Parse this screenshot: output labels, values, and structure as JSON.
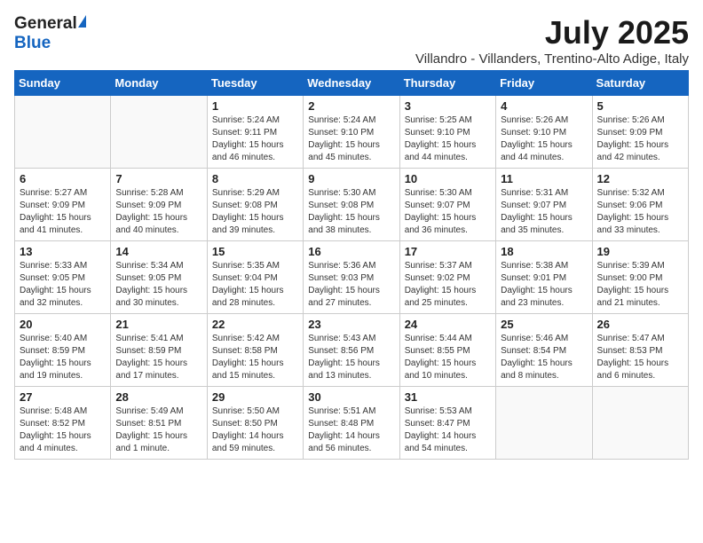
{
  "header": {
    "logo_general": "General",
    "logo_blue": "Blue",
    "month_title": "July 2025",
    "location": "Villandro - Villanders, Trentino-Alto Adige, Italy"
  },
  "calendar": {
    "days_of_week": [
      "Sunday",
      "Monday",
      "Tuesday",
      "Wednesday",
      "Thursday",
      "Friday",
      "Saturday"
    ],
    "weeks": [
      [
        {
          "day": "",
          "info": ""
        },
        {
          "day": "",
          "info": ""
        },
        {
          "day": "1",
          "info": "Sunrise: 5:24 AM\nSunset: 9:11 PM\nDaylight: 15 hours and 46 minutes."
        },
        {
          "day": "2",
          "info": "Sunrise: 5:24 AM\nSunset: 9:10 PM\nDaylight: 15 hours and 45 minutes."
        },
        {
          "day": "3",
          "info": "Sunrise: 5:25 AM\nSunset: 9:10 PM\nDaylight: 15 hours and 44 minutes."
        },
        {
          "day": "4",
          "info": "Sunrise: 5:26 AM\nSunset: 9:10 PM\nDaylight: 15 hours and 44 minutes."
        },
        {
          "day": "5",
          "info": "Sunrise: 5:26 AM\nSunset: 9:09 PM\nDaylight: 15 hours and 42 minutes."
        }
      ],
      [
        {
          "day": "6",
          "info": "Sunrise: 5:27 AM\nSunset: 9:09 PM\nDaylight: 15 hours and 41 minutes."
        },
        {
          "day": "7",
          "info": "Sunrise: 5:28 AM\nSunset: 9:09 PM\nDaylight: 15 hours and 40 minutes."
        },
        {
          "day": "8",
          "info": "Sunrise: 5:29 AM\nSunset: 9:08 PM\nDaylight: 15 hours and 39 minutes."
        },
        {
          "day": "9",
          "info": "Sunrise: 5:30 AM\nSunset: 9:08 PM\nDaylight: 15 hours and 38 minutes."
        },
        {
          "day": "10",
          "info": "Sunrise: 5:30 AM\nSunset: 9:07 PM\nDaylight: 15 hours and 36 minutes."
        },
        {
          "day": "11",
          "info": "Sunrise: 5:31 AM\nSunset: 9:07 PM\nDaylight: 15 hours and 35 minutes."
        },
        {
          "day": "12",
          "info": "Sunrise: 5:32 AM\nSunset: 9:06 PM\nDaylight: 15 hours and 33 minutes."
        }
      ],
      [
        {
          "day": "13",
          "info": "Sunrise: 5:33 AM\nSunset: 9:05 PM\nDaylight: 15 hours and 32 minutes."
        },
        {
          "day": "14",
          "info": "Sunrise: 5:34 AM\nSunset: 9:05 PM\nDaylight: 15 hours and 30 minutes."
        },
        {
          "day": "15",
          "info": "Sunrise: 5:35 AM\nSunset: 9:04 PM\nDaylight: 15 hours and 28 minutes."
        },
        {
          "day": "16",
          "info": "Sunrise: 5:36 AM\nSunset: 9:03 PM\nDaylight: 15 hours and 27 minutes."
        },
        {
          "day": "17",
          "info": "Sunrise: 5:37 AM\nSunset: 9:02 PM\nDaylight: 15 hours and 25 minutes."
        },
        {
          "day": "18",
          "info": "Sunrise: 5:38 AM\nSunset: 9:01 PM\nDaylight: 15 hours and 23 minutes."
        },
        {
          "day": "19",
          "info": "Sunrise: 5:39 AM\nSunset: 9:00 PM\nDaylight: 15 hours and 21 minutes."
        }
      ],
      [
        {
          "day": "20",
          "info": "Sunrise: 5:40 AM\nSunset: 8:59 PM\nDaylight: 15 hours and 19 minutes."
        },
        {
          "day": "21",
          "info": "Sunrise: 5:41 AM\nSunset: 8:59 PM\nDaylight: 15 hours and 17 minutes."
        },
        {
          "day": "22",
          "info": "Sunrise: 5:42 AM\nSunset: 8:58 PM\nDaylight: 15 hours and 15 minutes."
        },
        {
          "day": "23",
          "info": "Sunrise: 5:43 AM\nSunset: 8:56 PM\nDaylight: 15 hours and 13 minutes."
        },
        {
          "day": "24",
          "info": "Sunrise: 5:44 AM\nSunset: 8:55 PM\nDaylight: 15 hours and 10 minutes."
        },
        {
          "day": "25",
          "info": "Sunrise: 5:46 AM\nSunset: 8:54 PM\nDaylight: 15 hours and 8 minutes."
        },
        {
          "day": "26",
          "info": "Sunrise: 5:47 AM\nSunset: 8:53 PM\nDaylight: 15 hours and 6 minutes."
        }
      ],
      [
        {
          "day": "27",
          "info": "Sunrise: 5:48 AM\nSunset: 8:52 PM\nDaylight: 15 hours and 4 minutes."
        },
        {
          "day": "28",
          "info": "Sunrise: 5:49 AM\nSunset: 8:51 PM\nDaylight: 15 hours and 1 minute."
        },
        {
          "day": "29",
          "info": "Sunrise: 5:50 AM\nSunset: 8:50 PM\nDaylight: 14 hours and 59 minutes."
        },
        {
          "day": "30",
          "info": "Sunrise: 5:51 AM\nSunset: 8:48 PM\nDaylight: 14 hours and 56 minutes."
        },
        {
          "day": "31",
          "info": "Sunrise: 5:53 AM\nSunset: 8:47 PM\nDaylight: 14 hours and 54 minutes."
        },
        {
          "day": "",
          "info": ""
        },
        {
          "day": "",
          "info": ""
        }
      ]
    ]
  }
}
